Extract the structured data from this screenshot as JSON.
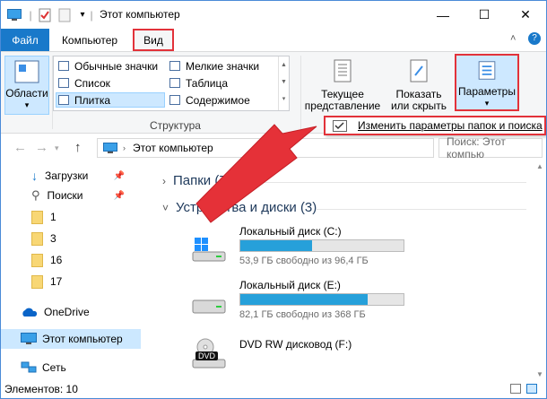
{
  "window": {
    "title": "Этот компьютер",
    "minimize_glyph": "—",
    "maximize_glyph": "☐",
    "close_glyph": "✕"
  },
  "menu": {
    "file": "Файл",
    "computer": "Компьютер",
    "view": "Вид"
  },
  "ribbon": {
    "panes_label": "Области",
    "layout": {
      "large_icons": "Обычные значки",
      "small_icons": "Мелкие значки",
      "list": "Список",
      "details": "Таблица",
      "tiles": "Плитка",
      "content": "Содержимое",
      "group_label": "Структура"
    },
    "current_view_line1": "Текущее",
    "current_view_line2": "представление",
    "show_hide_line1": "Показать",
    "show_hide_line2": "или скрыть",
    "options_label": "Параметры",
    "dropdown_item": "Изменить параметры папок и поиска"
  },
  "address": {
    "path": "Этот компьютер",
    "search_placeholder": "Поиск: Этот компью"
  },
  "sidebar": {
    "items": [
      {
        "label": "Загрузки",
        "pinned": true
      },
      {
        "label": "Поиски",
        "pinned": true
      },
      {
        "label": "1"
      },
      {
        "label": "3"
      },
      {
        "label": "16"
      },
      {
        "label": "17"
      },
      {
        "label": "OneDrive"
      },
      {
        "label": "Этот компьютер",
        "active": true
      },
      {
        "label": "Сеть"
      }
    ]
  },
  "content": {
    "folders_group": "Папки (7)",
    "devices_group": "Устройства и диски (3)",
    "drives": [
      {
        "name": "Локальный диск (C:)",
        "free_text": "53,9 ГБ свободно из 96,4 ГБ",
        "used_fraction": 0.44
      },
      {
        "name": "Локальный диск (E:)",
        "free_text": "82,1 ГБ свободно из 368 ГБ",
        "used_fraction": 0.78
      },
      {
        "name": "DVD RW дисковод (F:)"
      }
    ],
    "dvd_badge": "DVD"
  },
  "status": {
    "count": "Элементов: 10"
  },
  "colors": {
    "accent": "#1979ca",
    "highlight_red": "#e2323a",
    "bar_fill": "#26a0da",
    "selection": "#cce8ff"
  }
}
